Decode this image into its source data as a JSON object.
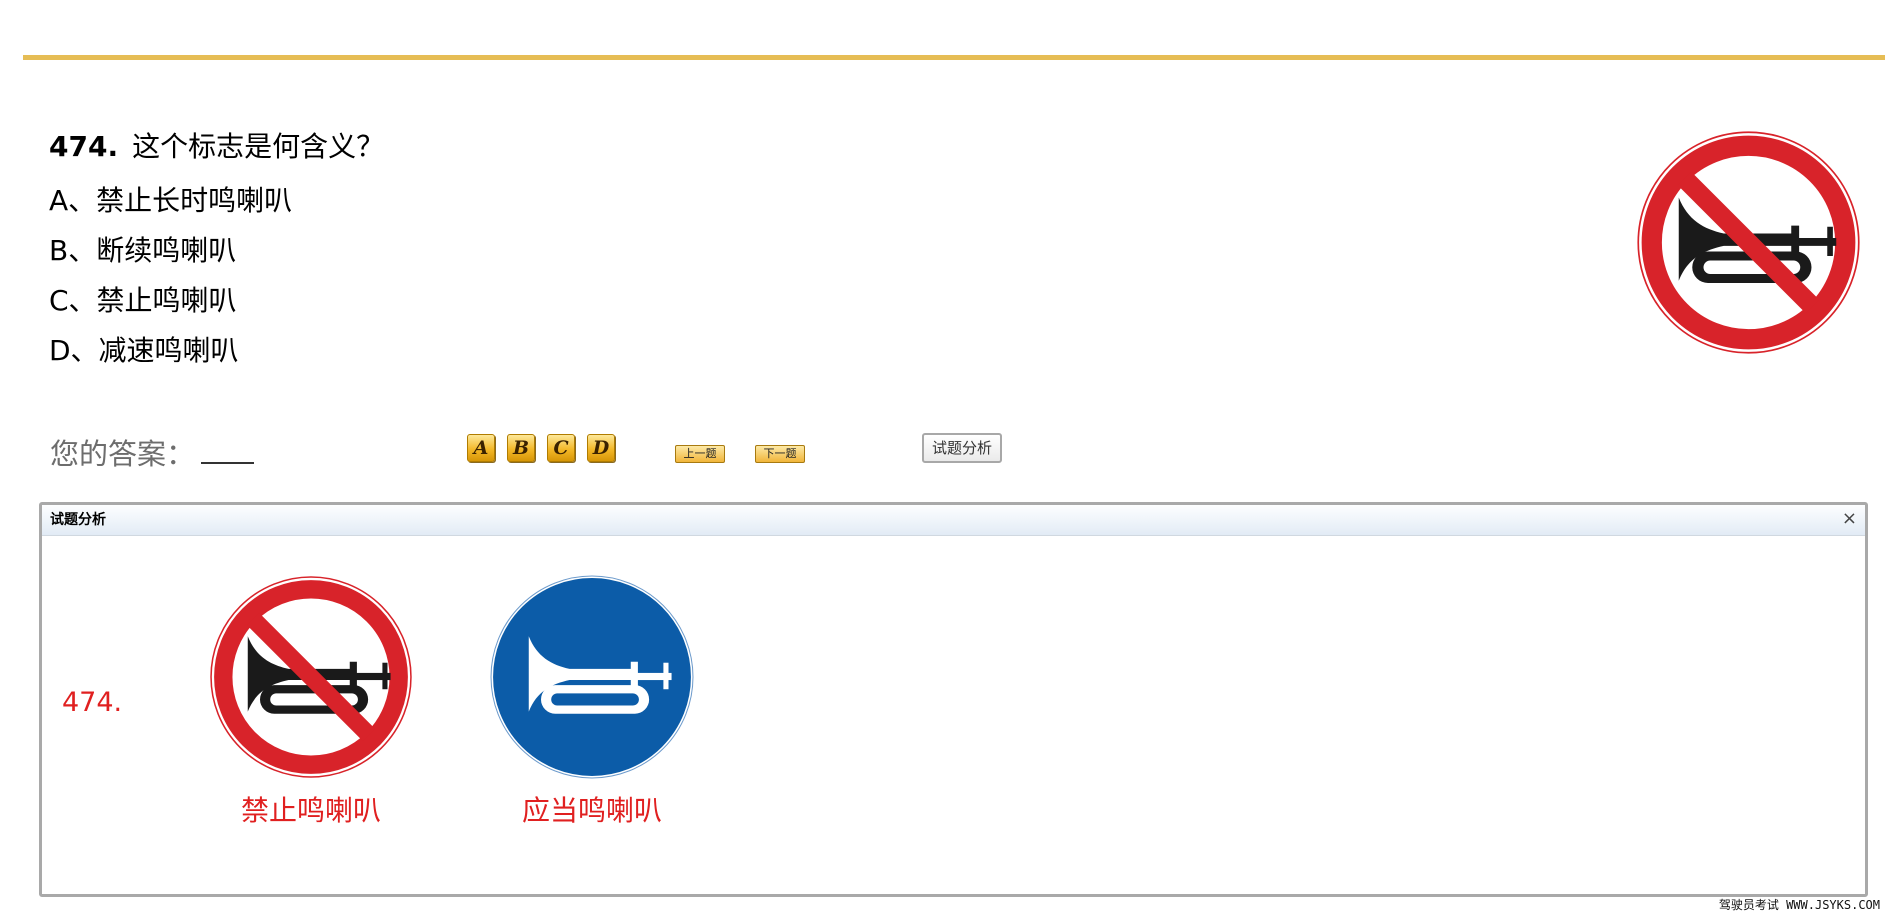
{
  "question": {
    "number": "474.",
    "text": "这个标志是何含义？",
    "options": [
      "A、禁止长时鸣喇叭",
      "B、断续鸣喇叭",
      "C、禁止鸣喇叭",
      "D、减速鸣喇叭"
    ]
  },
  "answer": {
    "label": "您的答案："
  },
  "choice_buttons": [
    "A",
    "B",
    "C",
    "D"
  ],
  "nav": {
    "prev": "上一题",
    "next": "下一题"
  },
  "analysis_button": "试题分析",
  "panel": {
    "title": "试题分析",
    "close": "×",
    "question_number": "474.",
    "captions": [
      "禁止鸣喇叭",
      "应当鸣喇叭"
    ]
  },
  "footer": "驾驶员考试 WWW.JSYKS.COM",
  "icons": {
    "question_sign": "no-honking-sign-icon",
    "panel_signs": [
      "no-honking-sign-icon",
      "honking-required-sign-icon"
    ]
  },
  "colors": {
    "accent_rule": "#e6bd55",
    "caption_red": "#e02020",
    "sign_red": "#d8232a",
    "sign_blue": "#0c5ca8"
  }
}
